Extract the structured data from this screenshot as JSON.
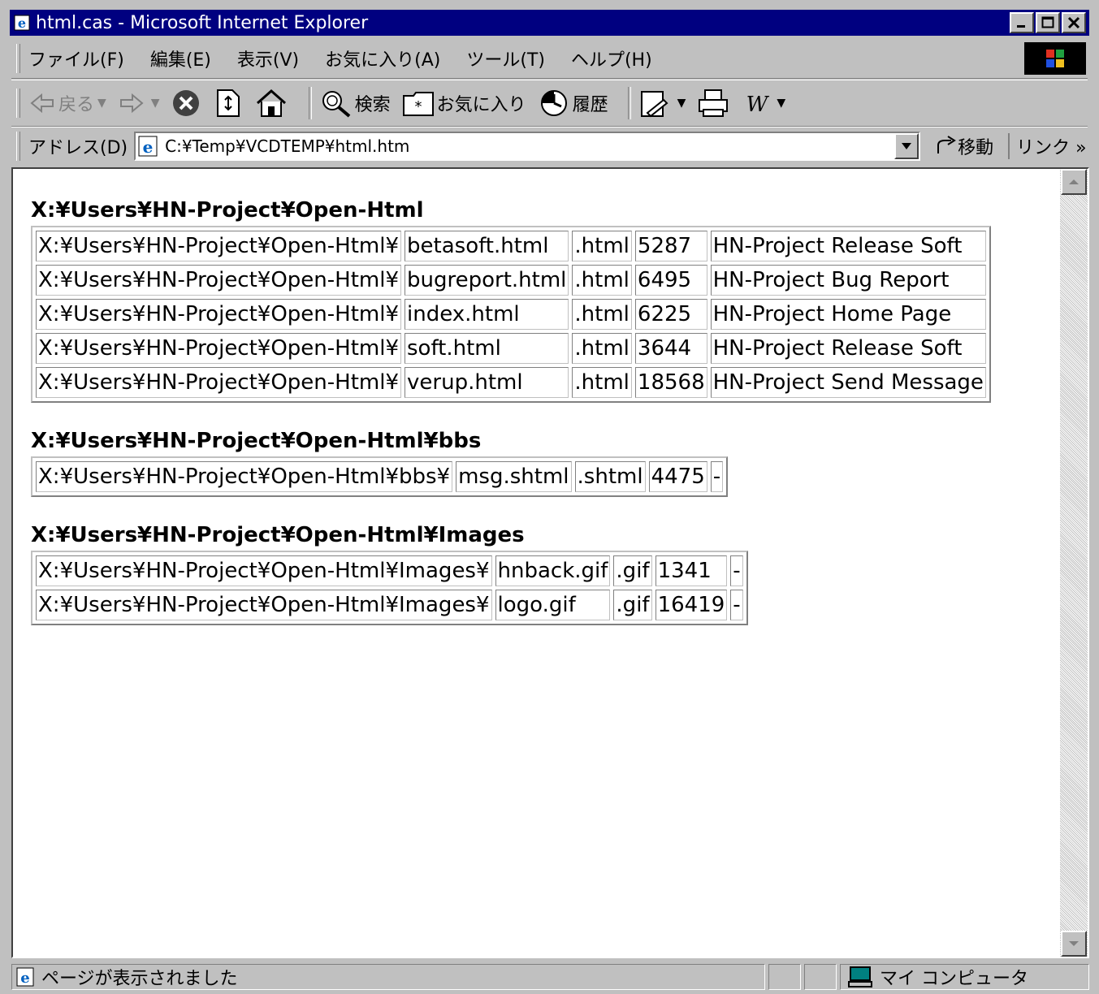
{
  "window": {
    "title": "html.cas - Microsoft Internet Explorer",
    "buttons": [
      "_",
      "□",
      "×"
    ]
  },
  "menu": [
    "ファイル(F)",
    "編集(E)",
    "表示(V)",
    "お気に入り(A)",
    "ツール(T)",
    "ヘルプ(H)"
  ],
  "toolbar": {
    "back": "戻る",
    "search": "検索",
    "favorites": "お気に入り",
    "history": "履歴"
  },
  "address": {
    "label": "アドレス(D)",
    "value": "C:¥Temp¥VCDTEMP¥html.htm",
    "go": "移動",
    "links": "リンク »"
  },
  "sections": [
    {
      "heading": "X:¥Users¥HN-Project¥Open-Html",
      "rows": [
        [
          "X:¥Users¥HN-Project¥Open-Html¥",
          "betasoft.html",
          ".html",
          "5287",
          "HN-Project Release Soft"
        ],
        [
          "X:¥Users¥HN-Project¥Open-Html¥",
          "bugreport.html",
          ".html",
          "6495",
          "HN-Project Bug Report"
        ],
        [
          "X:¥Users¥HN-Project¥Open-Html¥",
          "index.html",
          ".html",
          "6225",
          "HN-Project Home Page"
        ],
        [
          "X:¥Users¥HN-Project¥Open-Html¥",
          "soft.html",
          ".html",
          "3644",
          "HN-Project Release Soft"
        ],
        [
          "X:¥Users¥HN-Project¥Open-Html¥",
          "verup.html",
          ".html",
          "18568",
          "HN-Project Send Message"
        ]
      ]
    },
    {
      "heading": "X:¥Users¥HN-Project¥Open-Html¥bbs",
      "rows": [
        [
          "X:¥Users¥HN-Project¥Open-Html¥bbs¥",
          "msg.shtml",
          ".shtml",
          "4475",
          "-"
        ]
      ]
    },
    {
      "heading": "X:¥Users¥HN-Project¥Open-Html¥Images",
      "rows": [
        [
          "X:¥Users¥HN-Project¥Open-Html¥Images¥",
          "hnback.gif",
          ".gif",
          "1341",
          "-"
        ],
        [
          "X:¥Users¥HN-Project¥Open-Html¥Images¥",
          "logo.gif",
          ".gif",
          "16419",
          "-"
        ]
      ]
    }
  ],
  "status": {
    "text": "ページが表示されました",
    "zone": "マイ コンピュータ"
  }
}
